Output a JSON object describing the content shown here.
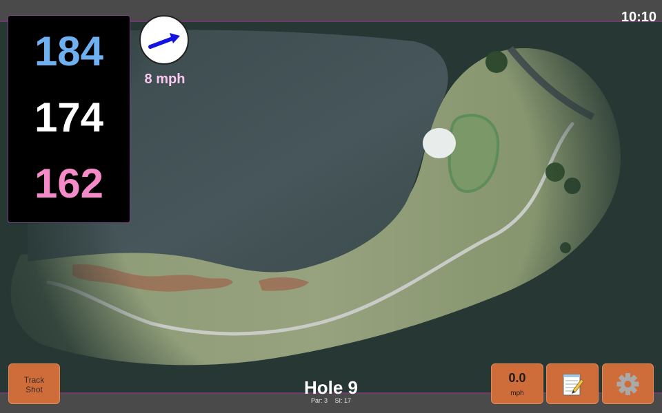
{
  "status_bar": {
    "time": "10:10"
  },
  "distances": {
    "back": "184",
    "middle": "174",
    "front": "162",
    "colors": {
      "back": "#6eb0f0",
      "middle": "#ffffff",
      "front": "#f48ac8"
    }
  },
  "wind": {
    "speed_label": "8 mph",
    "direction_icon": "arrow-icon",
    "arrow_color": "#1414e0"
  },
  "hole": {
    "title": "Hole 9",
    "par_label": "Par: 3",
    "stroke_index_label": "SI: 17"
  },
  "buttons": {
    "track_shot": [
      "Track",
      "Shot"
    ],
    "speed": {
      "value": "0.0",
      "unit": "mph"
    },
    "notes_icon": "notepad-icon",
    "settings_icon": "gear-icon"
  },
  "map": {
    "description_icon": "satellite-map",
    "accent_color": "#cf6d3a"
  }
}
